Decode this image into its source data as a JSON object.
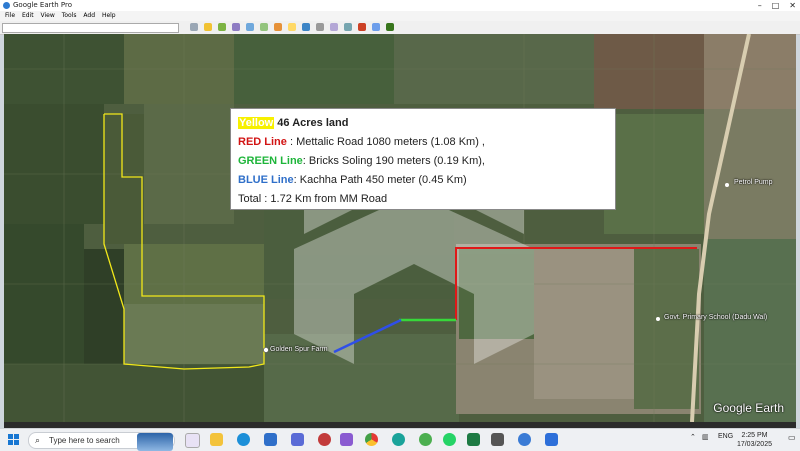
{
  "window": {
    "title": "Google Earth Pro"
  },
  "menu": [
    "File",
    "Edit",
    "View",
    "Tools",
    "Add",
    "Help"
  ],
  "info_box": {
    "line1": {
      "highlight": "Yellow",
      "text": " 46 Acres land"
    },
    "line2": {
      "label": "RED Line",
      "text": " : Mettalic Road 1080 meters (1.08 Km) ,"
    },
    "line3": {
      "label": "GREEN Line",
      "text": ": Bricks Soling 190 meters (0.19 Km),"
    },
    "line4": {
      "label": "BLUE Line",
      "text": ": Kachha Path 450 meter (0.45 Km)"
    },
    "line5": {
      "text": "Total : 1.72 Km from MM Road"
    }
  },
  "map_labels": {
    "petrol_pump": "Petrol Pump",
    "golden_spur_farm": "Golden Spur Farm",
    "school": "Govt. Primary School (Dadu Wal)"
  },
  "map_attribution": "Google Earth",
  "overlay_colors": {
    "yellow": "#f2e81a",
    "red": "#e01818",
    "green": "#37d83a",
    "blue": "#2f4fe8"
  },
  "taskbar": {
    "search_placeholder": "Type here to search",
    "apps": [
      "file-explorer",
      "edge",
      "mail",
      "store",
      "chrome",
      "edge-dev",
      "whatsapp",
      "excel",
      "google-earth",
      "snipping-tool"
    ],
    "language": "ENG",
    "time": "2:25 PM",
    "date": "17/03/2025"
  }
}
